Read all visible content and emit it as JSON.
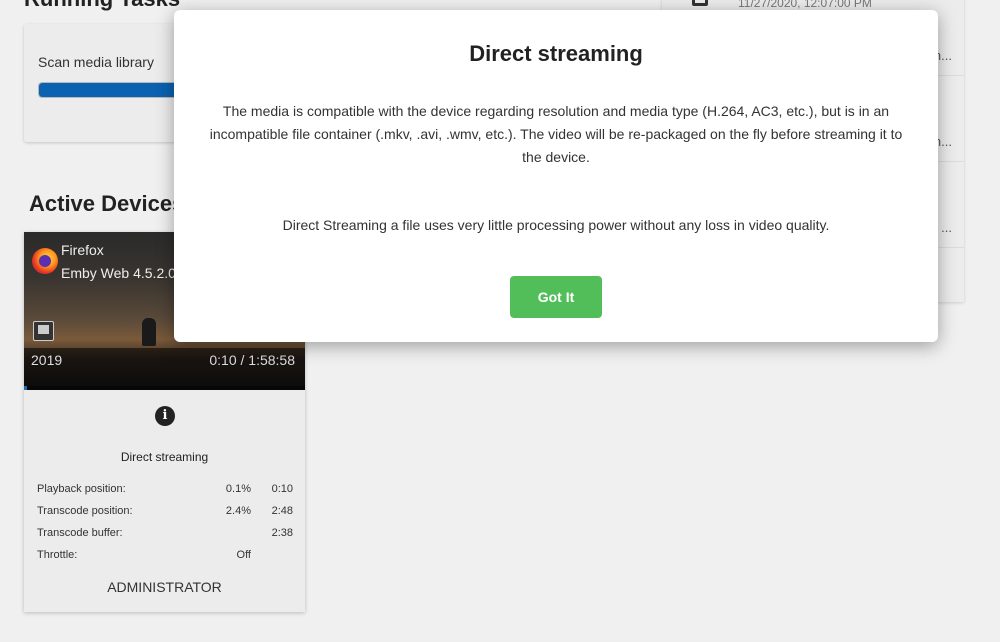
{
  "background": {
    "running_tasks_title": "Running Tasks",
    "task": {
      "name": "Scan media library",
      "progress_percent": 90
    },
    "right_list": {
      "rows": [
        {
          "text": "11/27/2020, 12:07:00 PM",
          "ellipsis": ""
        },
        {
          "text": "",
          "ellipsis": "n..."
        },
        {
          "text": "",
          "ellipsis": "n..."
        },
        {
          "text": "",
          "ellipsis": "..."
        }
      ]
    },
    "active_devices_title": "Active Devices"
  },
  "device": {
    "app_name": "Firefox",
    "app_version": "Emby Web 4.5.2.0",
    "year": "2019",
    "time": "0:10 / 1:58:58",
    "playback_progress_fraction": 0.01,
    "stream_method": "Direct streaming",
    "stats": [
      {
        "label": "Playback position:",
        "pct": "0.1%",
        "value": "0:10"
      },
      {
        "label": "Transcode position:",
        "pct": "2.4%",
        "value": "2:48"
      },
      {
        "label": "Transcode buffer:",
        "pct": "",
        "value": "2:38"
      },
      {
        "label": "Throttle:",
        "pct": "Off",
        "value": ""
      }
    ],
    "user": "ADMINISTRATOR"
  },
  "dialog": {
    "title": "Direct streaming",
    "body": "The media is compatible with the device regarding resolution and media type (H.264, AC3, etc.), but is in an incompatible file container (.mkv, .avi, .wmv, etc.). The video will be re-packaged on the fly before streaming it to the device.",
    "note": "Direct Streaming a file uses very little processing power without any loss in video quality.",
    "button_label": "Got It"
  },
  "colors": {
    "accent_button": "#52be5a",
    "progress_blue": "#0a62b0"
  },
  "icons": {
    "info": "info-icon",
    "browser": "firefox-icon",
    "media_type": "media-type-icon"
  }
}
